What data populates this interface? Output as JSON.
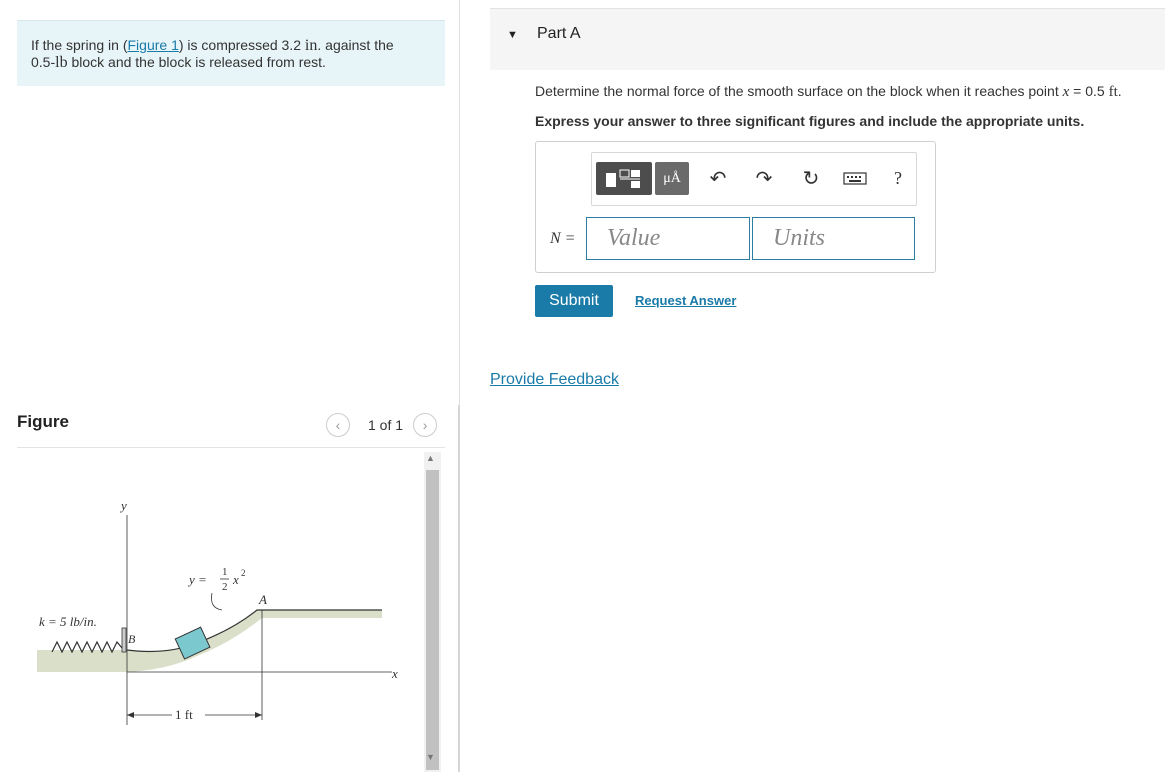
{
  "problem": {
    "text_before_link": "If the spring in (",
    "link_text": "Figure 1",
    "text_after_link": ") is compressed 3.2 ",
    "unit_in": "in",
    "text_mid": ". against the",
    "line2_prefix": "0.5-",
    "unit_lb": "lb",
    "line2_suffix": " block and the block is released from rest."
  },
  "figure_panel": {
    "title": "Figure",
    "prev_icon": "chevron-left-icon",
    "next_icon": "chevron-right-icon",
    "count": "1 of 1",
    "labels": {
      "y_axis": "y",
      "x_axis": "x",
      "curve_eq_lhs": "y =",
      "frac_num": "1",
      "frac_den": "2",
      "curve_var": "x",
      "curve_exp": "2",
      "point_a": "A",
      "point_b": "B",
      "spring_k": "k = 5 lb/in.",
      "distance": "1 ft"
    }
  },
  "part": {
    "title": "Part A",
    "caret_icon": "caret-down-icon",
    "question_prefix": "Determine the normal force of the smooth surface on the block when it reaches point ",
    "question_var": "x",
    "question_eq": " = 0.5 ",
    "question_unit": "ft",
    "question_end": ".",
    "instruction": "Express your answer to three significant figures and include the appropriate units.",
    "toolbar": {
      "units_glyph": "μÅ",
      "icons": [
        "templates-icon",
        "units-icon",
        "undo-icon",
        "redo-icon",
        "reset-icon",
        "keyboard-icon",
        "help-icon"
      ],
      "help_glyph": "?"
    },
    "var_label": "N =",
    "value_placeholder": "Value",
    "units_placeholder": "Units",
    "submit_label": "Submit",
    "request_answer_label": "Request Answer"
  },
  "feedback_label": "Provide Feedback",
  "colors": {
    "accent": "#1a7aa8",
    "problem_bg": "#e8f5f8",
    "block": "#7cc8cf",
    "ground": "#d9dfc8"
  }
}
